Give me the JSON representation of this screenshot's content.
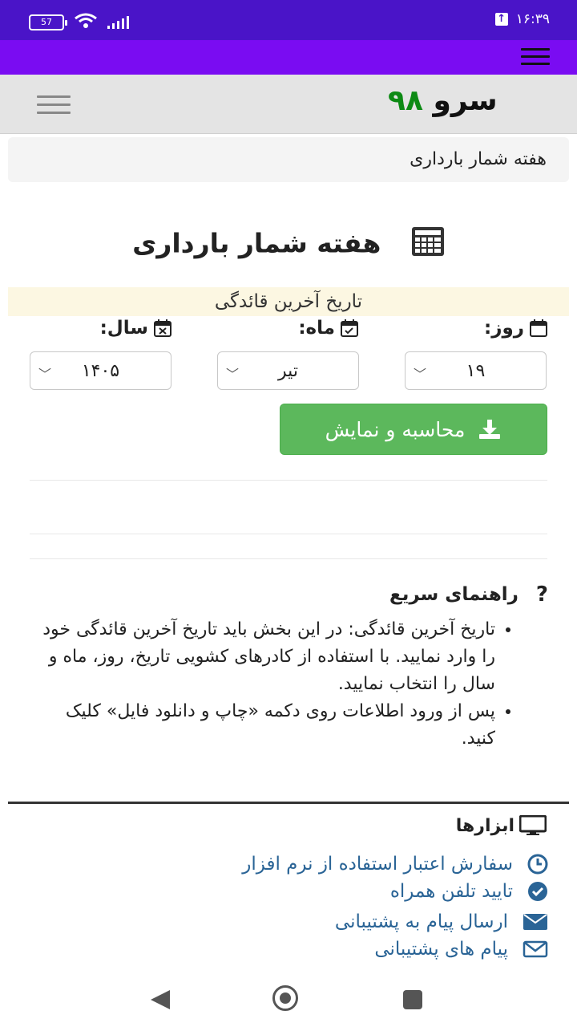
{
  "status_bar": {
    "battery": "57",
    "time": "۱۶:۳۹"
  },
  "header": {
    "logo_word": "سرو",
    "logo_number": "۹۸"
  },
  "breadcrumb": {
    "label": "هفته شمار بارداری"
  },
  "page": {
    "title": "هفته شمار بارداری"
  },
  "form": {
    "notice": "تاریخ آخرین قائدگی",
    "day": {
      "label": "روز:",
      "value": "۱۹"
    },
    "month": {
      "label": "ماه:",
      "value": "تیر"
    },
    "year": {
      "label": "سال:",
      "value": "۱۴۰۵"
    },
    "submit_label": "محاسبه و نمایش"
  },
  "guide": {
    "title": "راهنمای سریع",
    "items": [
      "تاریخ آخرین قائدگی: در این بخش باید تاریخ آخرین قائدگی خود را وارد نمایید. با استفاده از کادرهای کشویی تاریخ، روز، ماه و سال را انتخاب نمایید.",
      "پس از ورود اطلاعات روی دکمه «چاپ و دانلود فایل» کلیک کنید."
    ]
  },
  "tools": {
    "title": "ابزارها",
    "items": [
      {
        "label": "سفارش اعتبار استفاده از نرم افزار",
        "icon": "clock-icon"
      },
      {
        "label": "تایید تلفن همراه",
        "icon": "check-circle-icon"
      },
      {
        "label": "ارسال پیام به پشتیبانی",
        "icon": "envelope-icon"
      },
      {
        "label": "پیام های پشتیبانی",
        "icon": "envelope-outline-icon"
      }
    ]
  },
  "colors": {
    "status_bar": "#4a14c8",
    "top_bar": "#7a0cf2",
    "logo_number": "#0d8a14",
    "button": "#5cb85c",
    "link": "#2a6496"
  }
}
